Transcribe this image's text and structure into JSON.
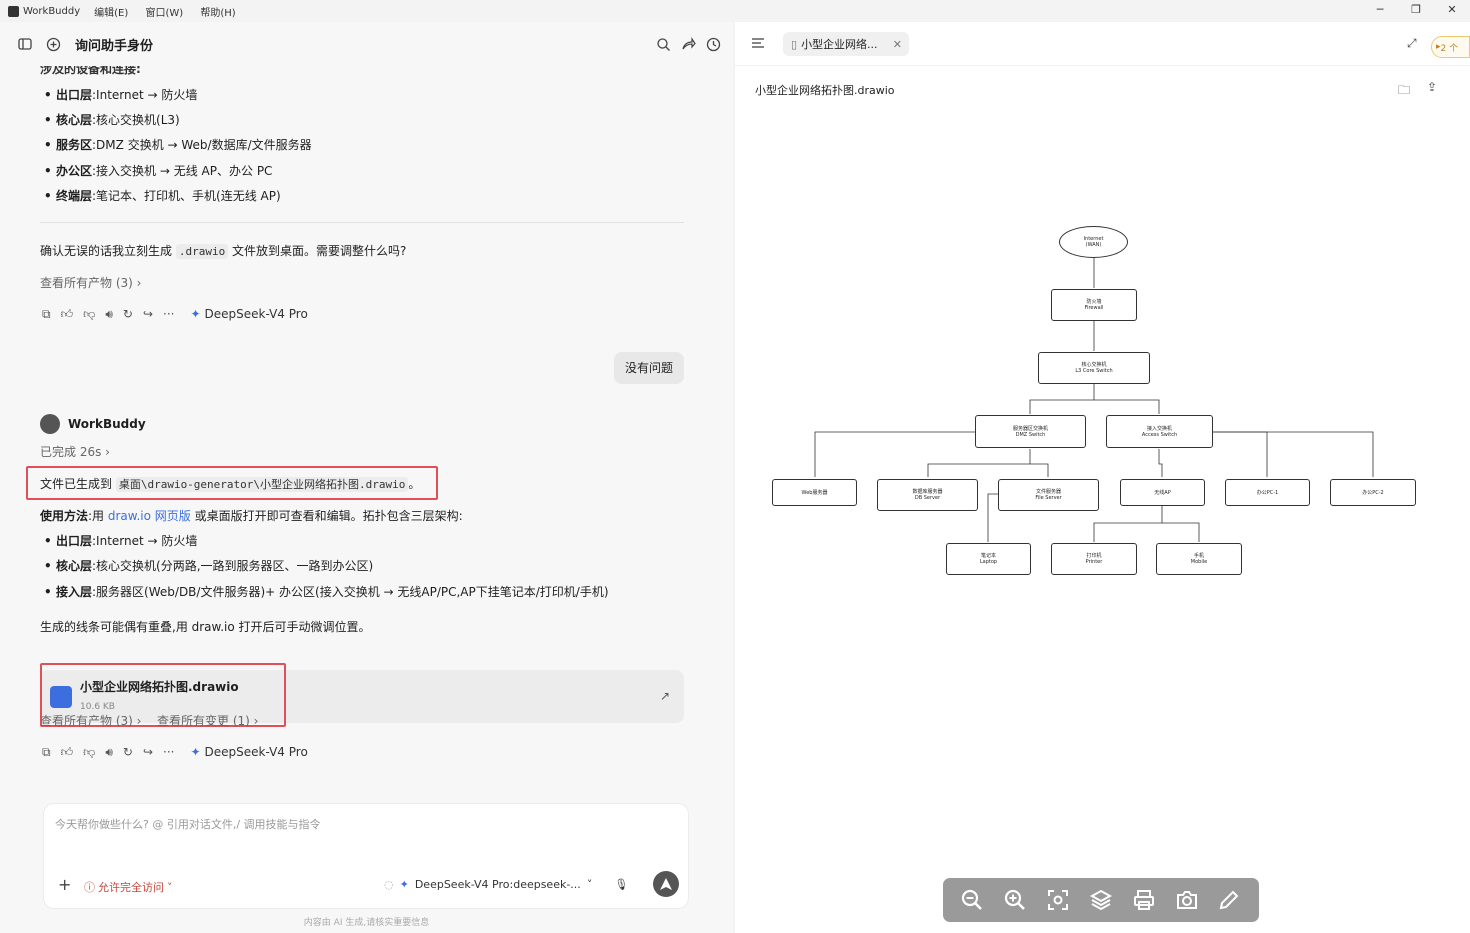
{
  "titlebar": {
    "app_name": "WorkBuddy",
    "menus": [
      "编辑(E)",
      "窗口(W)",
      "帮助(H)"
    ]
  },
  "chat": {
    "title": "询问助手身份",
    "top_partial": "涉及的设备和连接:",
    "layers": [
      {
        "k": "出口层",
        "v": ":Internet → 防火墙"
      },
      {
        "k": "核心层",
        "v": ":核心交换机(L3)"
      },
      {
        "k": "服务区",
        "v": ":DMZ 交换机 → Web/数据库/文件服务器"
      },
      {
        "k": "办公区",
        "v": ":接入交换机 → 无线 AP、办公 PC"
      },
      {
        "k": "终端层",
        "v": ":笔记本、打印机、手机(连无线 AP)"
      }
    ],
    "confirm_pre": "确认无误的话我立刻生成 ",
    "confirm_code": ".drawio",
    "confirm_post": " 文件放到桌面。需要调整什么吗?",
    "artifacts_link": "查看所有产物 (3)",
    "model": "DeepSeek-V4 Pro",
    "user_msg": "没有问题",
    "bot_name": "WorkBuddy",
    "done": "已完成 26s",
    "saved_pre": "文件已生成到 ",
    "saved_path": "桌面\\drawio-generator\\小型企业网络拓扑图.drawio",
    "saved_post": "。",
    "usage_pre": "使用方法",
    "usage_mid": ":用 ",
    "usage_link": "draw.io 网页版",
    "usage_post": " 或桌面版打开即可查看和编辑。拓扑包含三层架构:",
    "layers2": [
      {
        "k": "出口层",
        "v": ":Internet → 防火墙"
      },
      {
        "k": "核心层",
        "v": ":核心交换机(分两路,一路到服务器区、一路到办公区)"
      },
      {
        "k": "接入层",
        "v": ":服务器区(Web/DB/文件服务器)+ 办公区(接入交换机 → 无线AP/PC,AP下挂笔记本/打印机/手机)"
      }
    ],
    "note": "生成的线条可能偶有重叠,用 draw.io 打开后可手动微调位置。",
    "file_name": "小型企业网络拓扑图.drawio",
    "file_size": "10.6 KB",
    "artifacts_link2": "查看所有产物 (3)",
    "changes_link": "查看所有变更 (1)"
  },
  "input": {
    "placeholder": "今天帮你做些什么? @ 引用对话文件,/ 调用技能与指令",
    "access": "允许完全访问",
    "model": "DeepSeek-V4 Pro:deepseek-..."
  },
  "footer": "内容由 AI 生成,请核实重要信息",
  "preview": {
    "tab": "小型企业网络...",
    "badge": "2 个",
    "filename": "小型企业网络拓扑图.drawio",
    "nodes": {
      "internet": [
        "Internet",
        "(WAN)"
      ],
      "firewall": [
        "防火墙",
        "Firewall"
      ],
      "core": [
        "核心交换机",
        "L3 Core Switch"
      ],
      "dmz": [
        "服务器区交换机",
        "DMZ Switch"
      ],
      "access": [
        "接入交换机",
        "Access Switch"
      ],
      "web": [
        "Web服务器",
        ""
      ],
      "db": [
        "数据库服务器",
        "DB Server"
      ],
      "file": [
        "文件服务器",
        "File Server"
      ],
      "ap": [
        "无线AP",
        ""
      ],
      "pc1": [
        "办公PC-1",
        ""
      ],
      "pc2": [
        "办公PC-2",
        ""
      ],
      "laptop": [
        "笔记本",
        "Laptop"
      ],
      "printer": [
        "打印机",
        "Printer"
      ],
      "mobile": [
        "手机",
        "Mobile"
      ]
    }
  }
}
